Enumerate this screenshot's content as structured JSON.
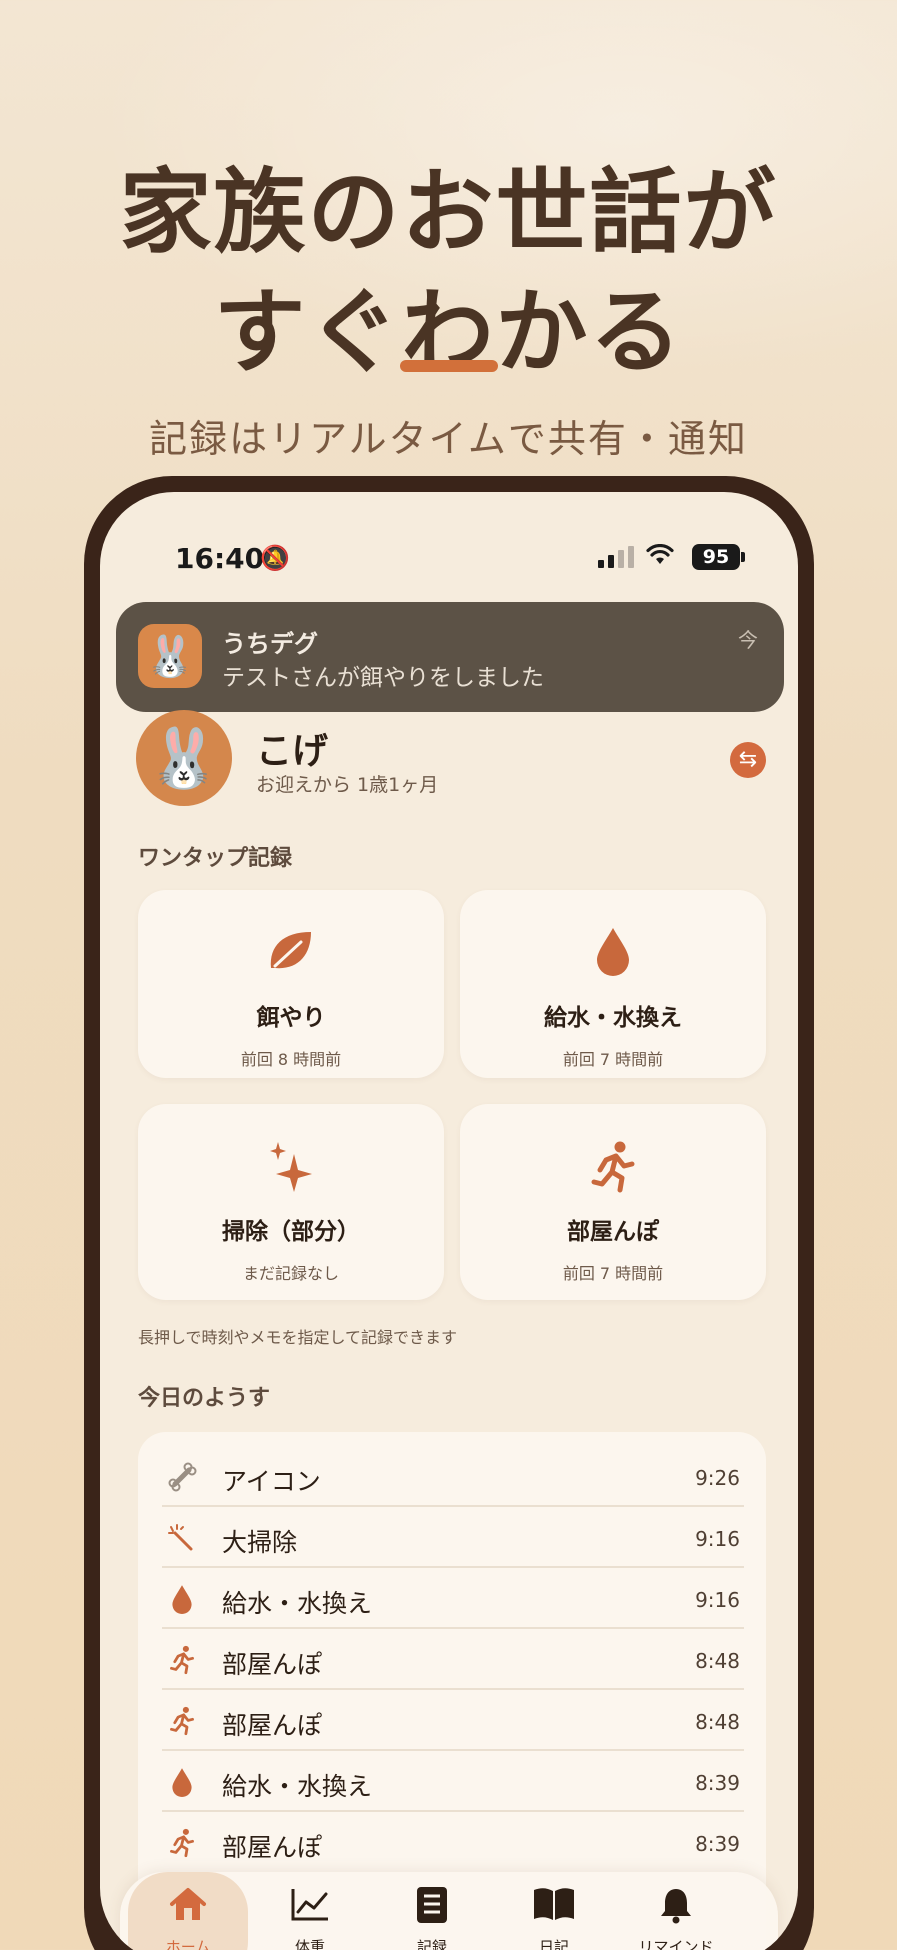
{
  "headline": {
    "line1": "家族のお世話が",
    "line2": "すぐわかる",
    "subtitle": "記録はリアルタイムで共有・通知"
  },
  "status_bar": {
    "time": "16:40",
    "battery": "95"
  },
  "notification": {
    "app_name": "うちデグ",
    "message": "テストさんが餌やりをしました",
    "time": "今"
  },
  "pet": {
    "name": "こげ",
    "age": "お迎えから 1歳1ヶ月"
  },
  "one_tap": {
    "title": "ワンタップ記録",
    "cards": [
      {
        "icon": "leaf-icon",
        "label": "餌やり",
        "last": "前回 8 時間前"
      },
      {
        "icon": "drop-icon",
        "label": "給水・水換え",
        "last": "前回 7 時間前"
      },
      {
        "icon": "sparkle-icon",
        "label": "掃除（部分）",
        "last": "まだ記録なし"
      },
      {
        "icon": "running-icon",
        "label": "部屋んぽ",
        "last": "前回 7 時間前"
      }
    ],
    "hint": "長押しで時刻やメモを指定して記録できます"
  },
  "today": {
    "title": "今日のようす",
    "rows": [
      {
        "icon": "bone-icon",
        "label": "アイコン",
        "time": "9:26"
      },
      {
        "icon": "wand-icon",
        "label": "大掃除",
        "time": "9:16"
      },
      {
        "icon": "drop-icon",
        "label": "給水・水換え",
        "time": "9:16"
      },
      {
        "icon": "running-icon",
        "label": "部屋んぽ",
        "time": "8:48"
      },
      {
        "icon": "running-icon",
        "label": "部屋んぽ",
        "time": "8:48"
      },
      {
        "icon": "drop-icon",
        "label": "給水・水換え",
        "time": "8:39"
      },
      {
        "icon": "running-icon",
        "label": "部屋んぽ",
        "time": "8:39"
      }
    ]
  },
  "tabs": [
    {
      "icon": "home-icon",
      "label": "ホーム",
      "active": true
    },
    {
      "icon": "chart-icon",
      "label": "体重"
    },
    {
      "icon": "list-icon",
      "label": "記録"
    },
    {
      "icon": "book-icon",
      "label": "日記"
    },
    {
      "icon": "bell-icon",
      "label": "リマインド"
    }
  ],
  "colors": {
    "accent": "#d36a3e",
    "icon_orange": "#c8683c",
    "background": "#f6ecdd",
    "frame": "#3a2419"
  }
}
